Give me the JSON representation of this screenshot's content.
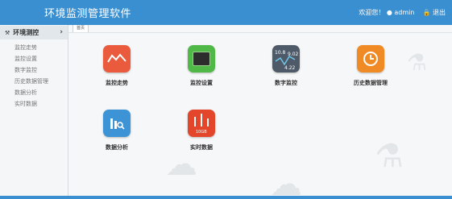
{
  "header": {
    "title": "环境监测管理软件",
    "welcome": "欢迎您！",
    "user": "admin",
    "logout": "退出"
  },
  "sidebar": {
    "section": "环境测控",
    "items": [
      {
        "label": "监控走势"
      },
      {
        "label": "监控设置"
      },
      {
        "label": "数字监控"
      },
      {
        "label": "历史数据管理"
      },
      {
        "label": "数据分析"
      },
      {
        "label": "实时数据"
      }
    ]
  },
  "tab": {
    "label": "首页"
  },
  "tiles": [
    {
      "label": "监控走势",
      "icon": "trend-chart-icon",
      "color": "#ea5a3c"
    },
    {
      "label": "监控设置",
      "icon": "chip-icon",
      "color": "#4fb847"
    },
    {
      "label": "数字监控",
      "icon": "digital-monitor-icon",
      "color": "#4f5a68",
      "values": [
        "10.8",
        "9.02",
        "4.22"
      ]
    },
    {
      "label": "历史数据管理",
      "icon": "clock-icon",
      "color": "#f08a24"
    },
    {
      "label": "数据分析",
      "icon": "analysis-icon",
      "color": "#3c93d6"
    },
    {
      "label": "实时数据",
      "icon": "realtime-bars-icon",
      "color": "#e3462b",
      "badge": "10GB"
    }
  ]
}
